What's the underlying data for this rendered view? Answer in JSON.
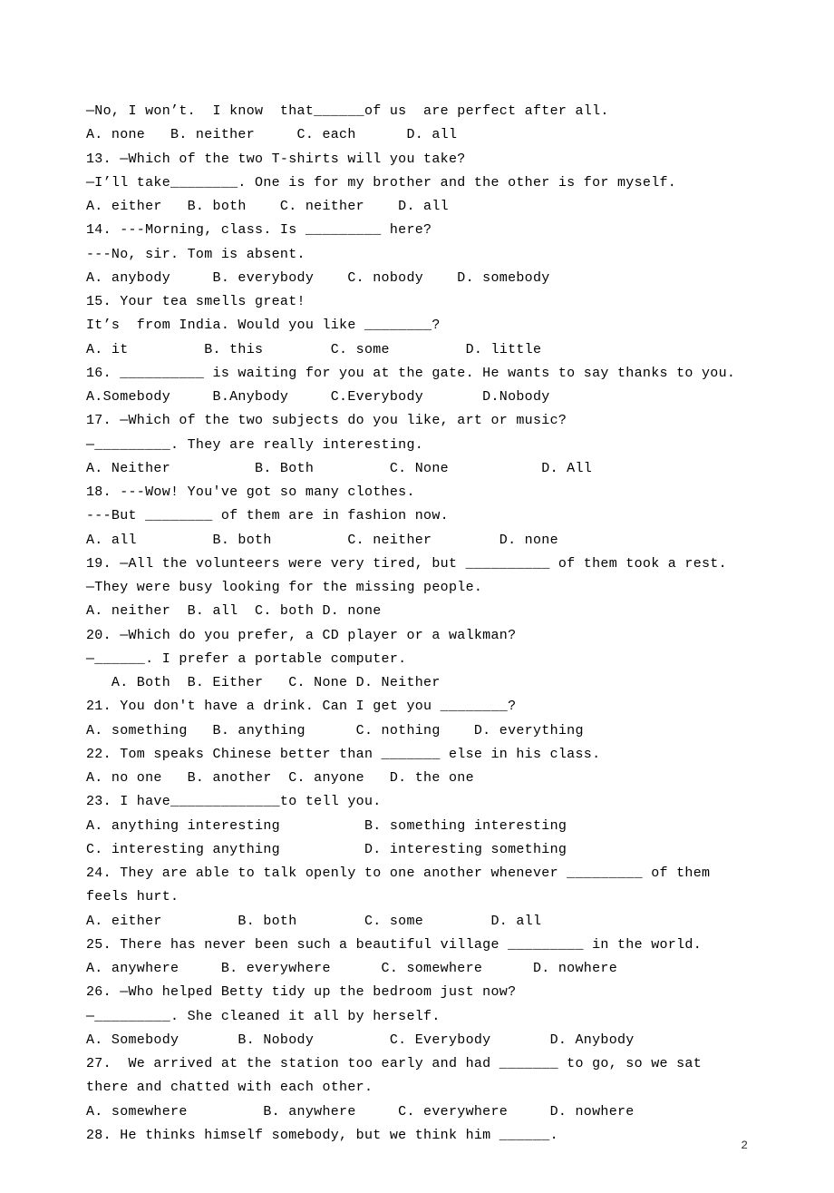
{
  "page_number": "2",
  "lines": [
    "—No, I won’t.  I know  that______of us  are perfect after all.",
    "A. none   B. neither     C. each      D. all",
    "13. —Which of the two T-shirts will you take?",
    "—I’ll take________. One is for my brother and the other is for myself.",
    "A. either   B. both    C. neither    D. all",
    "14. ---Morning, class. Is _________ here?",
    "---No, sir. Tom is absent.",
    "A. anybody     B. everybody    C. nobody    D. somebody",
    "15. Your tea smells great!",
    "It’s  from India. Would you like ________?",
    "A. it         B. this        C. some         D. little",
    "16. __________ is waiting for you at the gate. He wants to say thanks to you.",
    "A.Somebody     B.Anybody     C.Everybody       D.Nobody",
    "17. —Which of the two subjects do you like, art or music?",
    "—_________. They are really interesting.",
    "A. Neither          B. Both         C. None           D. All",
    "18. ---Wow! You've got so many clothes.",
    "---But ________ of them are in fashion now.",
    "A. all         B. both         C. neither        D. none",
    "19. —All the volunteers were very tired, but __________ of them took a rest.",
    "—They were busy looking for the missing people.",
    "A. neither  B. all  C. both D. none",
    "20. —Which do you prefer, a CD player or a walkman?",
    "—______. I prefer a portable computer.",
    "   A. Both  B. Either   C. None D. Neither",
    "21. You don't have a drink. Can I get you ________?",
    "A. something   B. anything      C. nothing    D. everything",
    "22. Tom speaks Chinese better than _______ else in his class.",
    "A. no one   B. another  C. anyone   D. the one",
    "23. I have_____________to tell you.",
    "A. anything interesting          B. something interesting",
    "C. interesting anything          D. interesting something",
    "24. They are able to talk openly to one another whenever _________ of them feels hurt.",
    "A. either         B. both        C. some        D. all",
    "25. There has never been such a beautiful village _________ in the world.",
    "A. anywhere     B. everywhere      C. somewhere      D. nowhere",
    "26. —Who helped Betty tidy up the bedroom just now?",
    "—_________. She cleaned it all by herself.",
    "A. Somebody       B. Nobody         C. Everybody       D. Anybody",
    "27.  We arrived at the station too early and had _______ to go, so we sat there and chatted with each other.",
    "A. somewhere         B. anywhere     C. everywhere     D. nowhere",
    "28. He thinks himself somebody, but we think him ______."
  ]
}
